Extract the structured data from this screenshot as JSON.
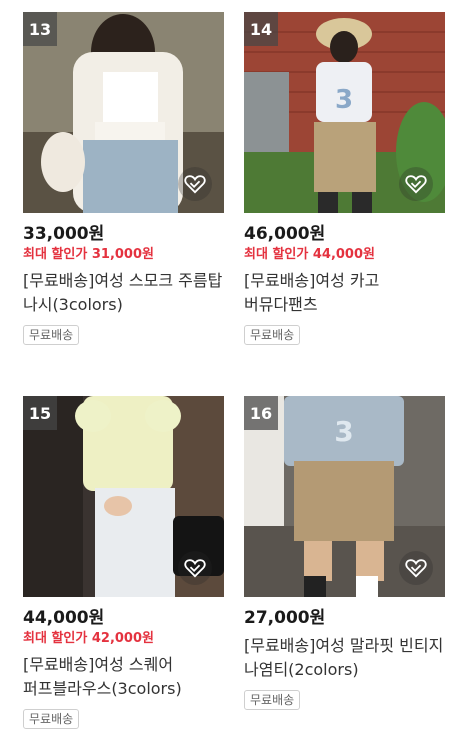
{
  "products": [
    {
      "rank": "13",
      "price": "33,000원",
      "discount_label": "최대 할인가",
      "discount_price": "31,000원",
      "name": "[무료배송]여성 스모크 주름탑 나시(3colors)",
      "badge": "무료배송",
      "like_icon": "heart-outline-icon"
    },
    {
      "rank": "14",
      "price": "46,000원",
      "discount_label": "최대 할인가",
      "discount_price": "44,000원",
      "name": "[무료배송]여성 카고 버뮤다팬츠",
      "badge": "무료배송",
      "like_icon": "heart-outline-icon"
    },
    {
      "rank": "15",
      "price": "44,000원",
      "discount_label": "최대 할인가",
      "discount_price": "42,000원",
      "name": "[무료배송]여성 스퀘어 퍼프블라우스(3colors)",
      "badge": "무료배송",
      "like_icon": "heart-outline-icon"
    },
    {
      "rank": "16",
      "price": "27,000원",
      "name": "[무료배송]여성 말라핏 빈티지 나염티(2colors)",
      "badge": "무료배송",
      "like_icon": "heart-outline-icon"
    }
  ],
  "colors": {
    "discount": "#e4323f",
    "price": "#1a1a1a",
    "rank_badge_bg": "#464646"
  }
}
